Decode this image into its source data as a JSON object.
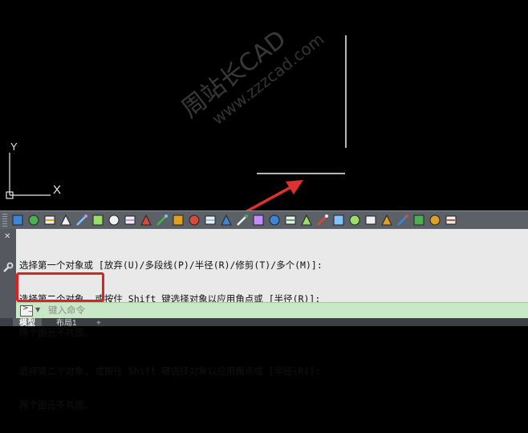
{
  "ucs": {
    "x_label": "X",
    "y_label": "Y"
  },
  "watermark": {
    "line1": "周站长CAD",
    "line2": "www.zzzcad.com"
  },
  "colors": {
    "canvas_bg": "#000000",
    "toolbar_bg": "#5c6168",
    "command_bg": "#e9e9e9",
    "input_bg": "#c9e9c6",
    "highlight": "#e02020",
    "arrow": "#e03030"
  },
  "toolbar": {
    "icons": [
      "new-icon",
      "save-icon",
      "properties-icon",
      "match-icon",
      "layer-icon",
      "circle-icon",
      "group-icon",
      "block-icon",
      "insert-icon",
      "dim-linear-icon",
      "dim-aligned-icon",
      "mirror-icon",
      "move-icon",
      "stretch-icon",
      "measure-icon",
      "select-window-icon",
      "draw-line-icon",
      "color-icon",
      "point-icon",
      "pen-icon",
      "lineweight-icon",
      "table-icon",
      "trim-icon",
      "extend-icon",
      "attribute-icon",
      "lamp-icon",
      "text-icon",
      "page-icon"
    ]
  },
  "command": {
    "history": [
      "选择第一个对象或 [放弃(U)/多段线(P)/半径(R)/修剪(T)/多个(M)]:",
      "选择第二个对象, 或按住 Shift 键选择对象以应用角点或 [半径(R)]:",
      "两个图元不共面。",
      "选择第二个对象, 或按住 Shift 键选择对象以应用角点或 [半径(R)]:",
      "两个图元不共面。"
    ],
    "input_placeholder": "键入命令"
  },
  "tabs": {
    "model": "模型",
    "layout1": "布局1",
    "add": "+"
  }
}
